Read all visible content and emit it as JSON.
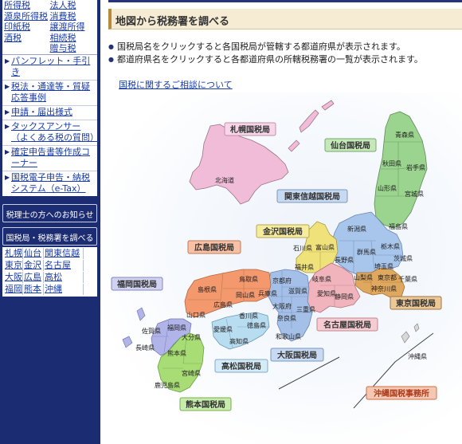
{
  "sidebar": {
    "tax_grid": [
      "所得税",
      "法人税",
      "源泉所得税",
      "消費税",
      "印紙税",
      "譲渡所得",
      "酒税",
      "相続税",
      "",
      "贈与税"
    ],
    "menu_items": [
      "パンフレット・手引き",
      "税法・通達等・質疑応答事例",
      "申請・届出様式",
      "タックスアンサー（よくある税の質問）",
      "確定申告書等作成コーナー",
      "国税電子申告・納税システム（e-Tax）"
    ],
    "btn_zeirishi": "税理士の方へのお知らせ",
    "btn_bureau": "国税局・税務署を調べる",
    "bureau_links": [
      "札幌",
      "仙台",
      "関東信越",
      "東京",
      "金沢",
      "名古屋",
      "大阪",
      "広島",
      "高松",
      "福岡",
      "熊本",
      "沖縄"
    ]
  },
  "main": {
    "heading": "地図から税務署を調べる",
    "bullets": [
      "国税局名をクリックすると各国税局が管轄する都道府県が表示されます。",
      "都道府県名をクリックすると各都道府県の所轄税務署の一覧が表示されます。"
    ],
    "consult_link": "国税に関するご相談について"
  },
  "map": {
    "bureaus": {
      "sapporo": "札幌国税局",
      "sendai": "仙台国税局",
      "kanto": "関東信越国税局",
      "kanazawa": "金沢国税局",
      "hiroshima": "広島国税局",
      "fukuoka": "福岡国税局",
      "tokyo": "東京国税局",
      "nagoya": "名古屋国税局",
      "osaka": "大阪国税局",
      "takamatsu": "高松国税局",
      "kumamoto": "熊本国税局",
      "okinawa": "沖縄国税事務所"
    },
    "prefs": {
      "hokkaido": "北海道",
      "aomori": "青森県",
      "akita": "秋田県",
      "iwate": "岩手県",
      "yamagata": "山形県",
      "miyagi": "宮城県",
      "fukushima": "福島県",
      "niigata": "新潟県",
      "nagano": "長野県",
      "gunma": "群馬県",
      "tochigi": "栃木県",
      "ibaraki": "茨城県",
      "saitama": "埼玉県",
      "tokyo": "東京都",
      "chiba": "千葉県",
      "kanagawa": "神奈川県",
      "yamanashi": "山梨県",
      "toyama": "富山県",
      "ishikawa": "石川県",
      "fukui": "福井県",
      "gifu": "岐阜県",
      "aichi": "愛知県",
      "shizuoka": "静岡県",
      "mie": "三重県",
      "kyoto": "京都府",
      "shiga": "滋賀県",
      "osaka": "大阪府",
      "hyogo": "兵庫県",
      "nara": "奈良県",
      "wakayama": "和歌山県",
      "tottori": "鳥取県",
      "shimane": "島根県",
      "okayama": "岡山県",
      "hiroshima": "広島県",
      "yamaguchi": "山口県",
      "kagawa": "香川県",
      "tokushima": "徳島県",
      "ehime": "愛媛県",
      "kochi": "高知県",
      "fukuoka": "福岡県",
      "saga": "佐賀県",
      "nagasaki": "長崎県",
      "oita": "大分県",
      "kumamoto": "熊本県",
      "miyazaki": "宮崎県",
      "kagoshima": "鹿児島県",
      "okinawa": "沖縄県"
    },
    "colors": {
      "sapporo": "#f0bcd8",
      "sendai": "#9ad48e",
      "kanto": "#a8c6ec",
      "kanazawa": "#f0e27a",
      "tokyo": "#dfa85e",
      "nagoya": "#f2b4bc",
      "osaka": "#a5c0e8",
      "hiroshima": "#f4986e",
      "takamatsu": "#b8dcf0",
      "fukuoka": "#b0b4e8",
      "kumamoto": "#a8dc74",
      "okinawa_label": "#e06a40"
    }
  }
}
